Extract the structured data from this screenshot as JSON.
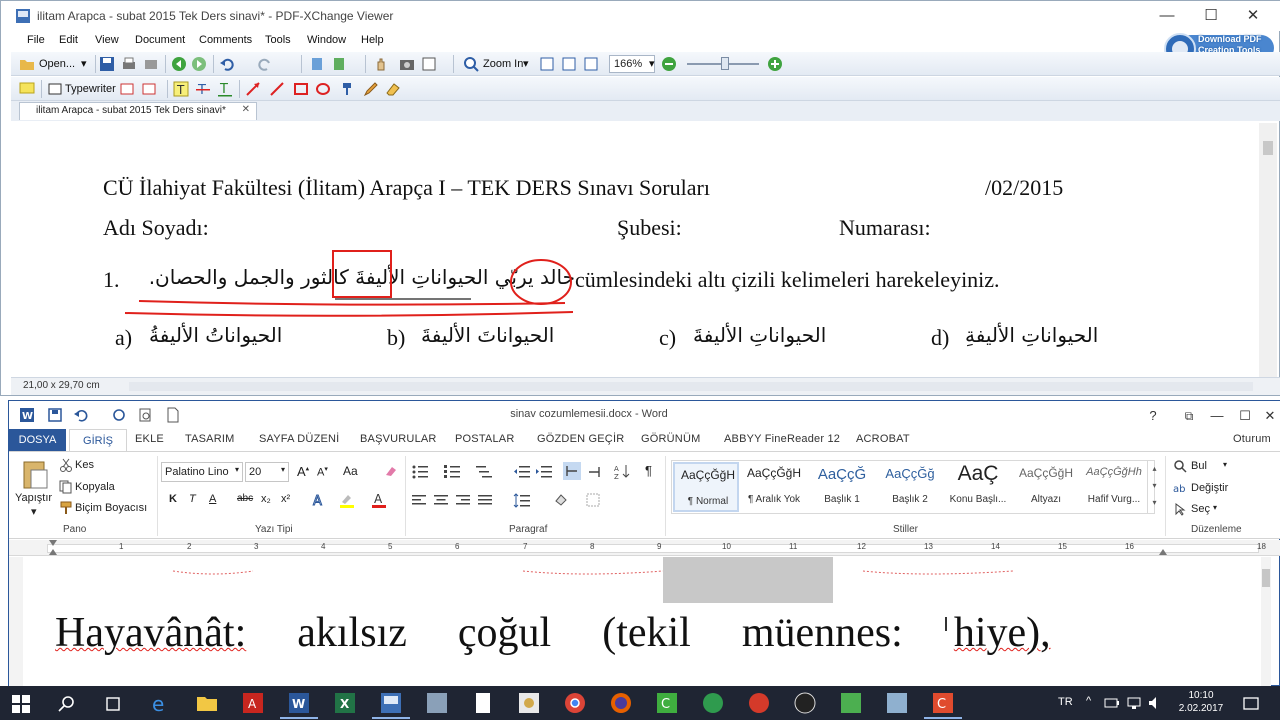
{
  "colors": {
    "pdf_frame": "#9aabbb",
    "word_blue": "#2b579a",
    "annot_red": "#e0201b",
    "taskbar": "#1f2533"
  },
  "pdf": {
    "title": "ilitam Arapca - subat 2015 Tek Ders sinavi* - PDF-XChange Viewer",
    "app_icon": "pdf-xchange-icon",
    "window_controls": {
      "minimize": "—",
      "maximize": "☐",
      "close": "✕"
    },
    "menu": [
      "File",
      "Edit",
      "View",
      "Document",
      "Comments",
      "Tools",
      "Window",
      "Help"
    ],
    "toolbar1": {
      "open_label": "Open...",
      "zoom_in_label": "Zoom In",
      "zoom_value": "166%"
    },
    "toolbar2": {
      "typewriter_label": "Typewriter"
    },
    "promo": {
      "line1": "Download PDF",
      "line2": "Creation Tools"
    },
    "tab": {
      "label": "ilitam Arapca - subat 2015 Tek Ders sinavi*",
      "close": "✕"
    },
    "status": {
      "page_size": "21,00 x 29,70 cm"
    },
    "document": {
      "line1_title": "CÜ İlahiyat Fakültesi (İlitam) Arapça I – TEK DERS Sınavı Soruları",
      "line1_date": "/02/2015",
      "line2_name": "Adı Soyadı:",
      "line2_branch": "Şubesi:",
      "line2_number": "Numarası:",
      "q1_number": "1.",
      "q1_arabic_sentence": "خالد يربّي الحيواناتِ الأليفةَ كالثور والجمل والحصان.",
      "q1_arabic_circled": "خالد",
      "q1_arabic_boxed": "الأليفةَ",
      "q1_turkish": "cümlesindeki altı çizili kelimeleri harekeleyiniz.",
      "options": [
        {
          "letter": "a)",
          "text": "الحيواناتُ الأليفةُ"
        },
        {
          "letter": "b)",
          "text": "الحيواناتَ الأليفةَ"
        },
        {
          "letter": "c)",
          "text": "الحيواناتِ الأليفةَ"
        },
        {
          "letter": "d)",
          "text": "الحيواناتِ الأليفةِ"
        }
      ]
    }
  },
  "word": {
    "title": "sinav cozumlemesii.docx - Word",
    "help": "?",
    "window_controls": {
      "restore": "⧉",
      "minimize": "—",
      "maximize": "☐",
      "close": "✕"
    },
    "signin": "Oturum",
    "tabs": [
      "DOSYA",
      "GİRİŞ",
      "EKLE",
      "TASARIM",
      "SAYFA DÜZENİ",
      "BAŞVURULAR",
      "POSTALAR",
      "GÖZDEN GEÇİR",
      "GÖRÜNÜM",
      "ABBYY FineReader 12",
      "ACROBAT"
    ],
    "clipboard": {
      "paste": "Yapıştır",
      "cut": "Kes",
      "copy": "Kopyala",
      "format_painter": "Biçim Boyacısı",
      "label": "Pano"
    },
    "font": {
      "family": "Palatino Lino",
      "size": "20",
      "label": "Yazı Tipi",
      "case_btn": "Aa",
      "bold": "K",
      "italic": "T",
      "underline": "A",
      "strike": "abc",
      "sub": "x₂",
      "sup": "x²"
    },
    "paragraph": {
      "label": "Paragraf"
    },
    "styles": {
      "label": "Stiller",
      "items": [
        {
          "sample": "AaÇçĞğH",
          "name": "¶ Normal"
        },
        {
          "sample": "AaÇçĞğH",
          "name": "¶ Aralık Yok"
        },
        {
          "sample": "AaÇçĞ",
          "name": "Başlık 1"
        },
        {
          "sample": "AaÇçĞğ",
          "name": "Başlık 2"
        },
        {
          "sample": "AaÇ",
          "name": "Konu Başlı..."
        },
        {
          "sample": "AaÇçĞğH",
          "name": "Altyazı"
        },
        {
          "sample": "AaÇçĞğHh",
          "name": "Hafif Vurg..."
        }
      ]
    },
    "editing": {
      "find": "Bul",
      "replace": "Değiştir",
      "select": "Seç",
      "label": "Düzenleme"
    },
    "ruler": [
      "1",
      "2",
      "3",
      "4",
      "5",
      "6",
      "7",
      "8",
      "9",
      "10",
      "11",
      "12",
      "13",
      "14",
      "15",
      "16",
      "18"
    ],
    "page_text": {
      "w1": "Hayavânât:",
      "w2": "akılsız",
      "w3": "çoğul",
      "w4": "(tekil",
      "w5": "müennes:",
      "w6": "hiye),"
    }
  },
  "taskbar": {
    "language": "TR",
    "time": "10:10",
    "date": "2.02.2017"
  }
}
